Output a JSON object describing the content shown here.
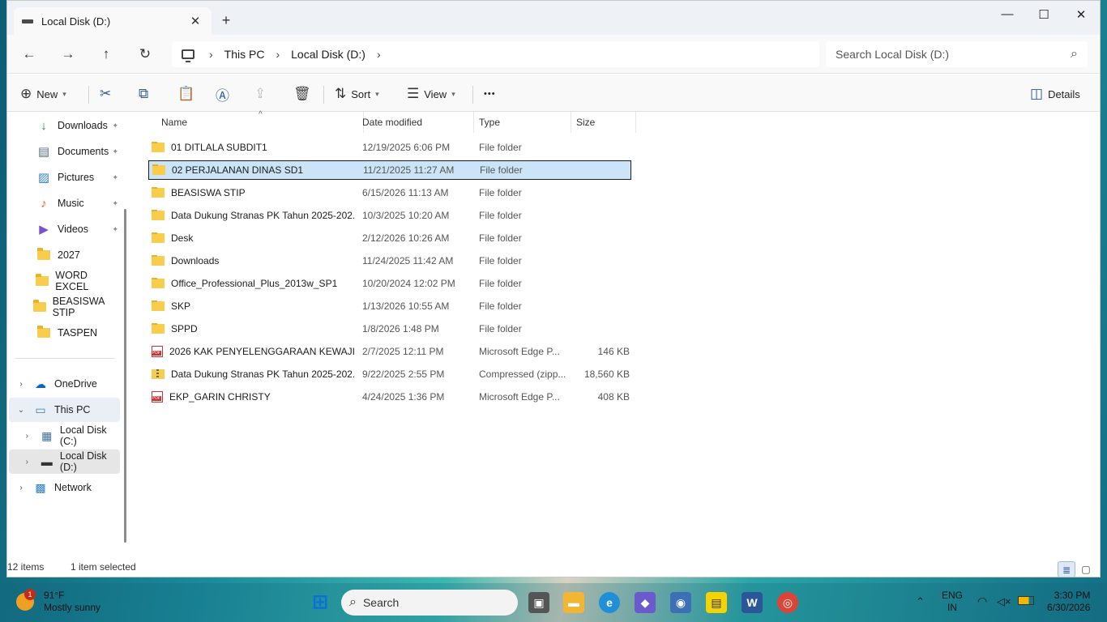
{
  "window": {
    "tab_title": "Local Disk (D:)",
    "controls": {
      "minimize": "—",
      "maximize": "☐",
      "close": "✕"
    },
    "new_tab": "+",
    "tab_close": "✕"
  },
  "nav": {
    "back": "←",
    "forward": "→",
    "up": "↑",
    "refresh": "↻",
    "breadcrumb": [
      "This PC",
      "Local Disk (D:)"
    ],
    "chevron": "›",
    "search_placeholder": "Search Local Disk (D:)",
    "search_icon": "⌕"
  },
  "toolbar": {
    "new": "New",
    "sort": "Sort",
    "view": "View",
    "details": "Details",
    "more": "•••",
    "icons": [
      "cut-icon",
      "copy-icon",
      "paste-icon",
      "rename-icon",
      "share-icon",
      "delete-icon"
    ]
  },
  "sidebar": {
    "quick": [
      {
        "label": "Downloads",
        "icon": "download-icon",
        "pinned": true
      },
      {
        "label": "Documents",
        "icon": "documents-icon",
        "pinned": true
      },
      {
        "label": "Pictures",
        "icon": "pictures-icon",
        "pinned": true
      },
      {
        "label": "Music",
        "icon": "music-icon",
        "pinned": true
      },
      {
        "label": "Videos",
        "icon": "videos-icon",
        "pinned": true
      },
      {
        "label": "2027",
        "icon": "folder-icon",
        "pinned": false
      },
      {
        "label": "WORD EXCEL",
        "icon": "folder-icon",
        "pinned": false
      },
      {
        "label": "BEASISWA STIP",
        "icon": "folder-icon",
        "pinned": false
      },
      {
        "label": "TASPEN",
        "icon": "folder-icon",
        "pinned": false
      }
    ],
    "tree": [
      {
        "label": "OneDrive",
        "expander": "›",
        "level": 0
      },
      {
        "label": "This PC",
        "expander": "⌄",
        "level": 0,
        "hover": true
      },
      {
        "label": "Local Disk (C:)",
        "expander": "›",
        "level": 1
      },
      {
        "label": "Local Disk (D:)",
        "expander": "›",
        "level": 1,
        "selected": true
      },
      {
        "label": "Network",
        "expander": "›",
        "level": 0
      }
    ],
    "pin_glyph": "📌"
  },
  "columns": {
    "name": "Name",
    "date": "Date modified",
    "type": "Type",
    "size": "Size",
    "sort_glyph": "^"
  },
  "files": [
    {
      "name": "01 DITLALA SUBDIT1",
      "date": "12/19/2025 6:06 PM",
      "type": "File folder",
      "size": "",
      "kind": "folder"
    },
    {
      "name": "02 PERJALANAN DINAS SD1",
      "date": "11/21/2025 11:27 AM",
      "type": "File folder",
      "size": "",
      "kind": "folder",
      "selected": true
    },
    {
      "name": "BEASISWA STIP",
      "date": "6/15/2026 11:13 AM",
      "type": "File folder",
      "size": "",
      "kind": "folder"
    },
    {
      "name": "Data Dukung Stranas PK Tahun 2025-202...",
      "date": "10/3/2025 10:20 AM",
      "type": "File folder",
      "size": "",
      "kind": "folder"
    },
    {
      "name": "Desk",
      "date": "2/12/2026 10:26 AM",
      "type": "File folder",
      "size": "",
      "kind": "folder"
    },
    {
      "name": "Downloads",
      "date": "11/24/2025 11:42 AM",
      "type": "File folder",
      "size": "",
      "kind": "folder"
    },
    {
      "name": "Office_Professional_Plus_2013w_SP1",
      "date": "10/20/2024 12:02 PM",
      "type": "File folder",
      "size": "",
      "kind": "folder"
    },
    {
      "name": "SKP",
      "date": "1/13/2026 10:55 AM",
      "type": "File folder",
      "size": "",
      "kind": "folder"
    },
    {
      "name": "SPPD",
      "date": "1/8/2026 1:48 PM",
      "type": "File folder",
      "size": "",
      "kind": "folder"
    },
    {
      "name": "2026 KAK PENYELENGGARAAN KEWAJIB...",
      "date": "2/7/2025 12:11 PM",
      "type": "Microsoft Edge P...",
      "size": "146 KB",
      "kind": "pdf"
    },
    {
      "name": "Data Dukung Stranas PK Tahun 2025-202...",
      "date": "9/22/2025 2:55 PM",
      "type": "Compressed (zipp...",
      "size": "18,560 KB",
      "kind": "zip"
    },
    {
      "name": "EKP_GARIN CHRISTY",
      "date": "4/24/2025 1:36 PM",
      "type": "Microsoft Edge P...",
      "size": "408 KB",
      "kind": "pdf"
    }
  ],
  "status": {
    "count": "12 items",
    "selection": "1 item selected"
  },
  "taskbar": {
    "weather_temp": "91°F",
    "weather_desc": "Mostly sunny",
    "weather_badge": "1",
    "search_label": "Search",
    "lang_top": "ENG",
    "lang_bottom": "IN",
    "time": "3:30 PM",
    "date": "6/30/2026",
    "apps": [
      "windows-start-icon",
      "task-view-icon",
      "file-explorer-icon",
      "edge-icon",
      "copilot-icon",
      "camera-icon",
      "sticky-notes-icon",
      "word-icon",
      "chrome-icon"
    ]
  },
  "colors": {
    "selection_bg": "#cce4f7",
    "accent": "#2b579a",
    "folder": "#f8cc4d",
    "pdf": "#d12b2b"
  }
}
